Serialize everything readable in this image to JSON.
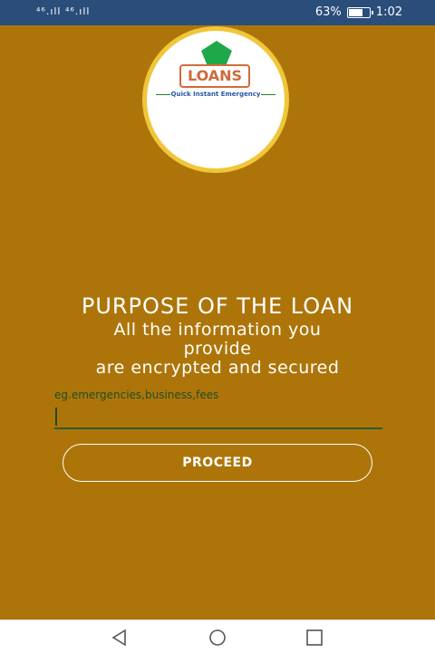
{
  "status_bar": {
    "signal": "⁴⁶.ıll ⁴⁶.ıll",
    "battery_percent": "63%",
    "time": "1:02"
  },
  "logo": {
    "brand": "LOANS",
    "tagline": "Quick Instant Emergency",
    "colors": {
      "pentagon": "#1fa84a",
      "ring": "#f0c63a",
      "brand_text": "#d06a3a",
      "tagline": "#2a56a3"
    }
  },
  "form": {
    "title": "PURPOSE OF THE LOAN",
    "subtitle_line1": "All the information you",
    "subtitle_line2": "provide",
    "subtitle_line3": "are encrypted and secured",
    "input_label": "eg.emergencies,business,fees",
    "input_value": "",
    "proceed_label": "PROCEED"
  },
  "nav": {
    "back": "back-icon",
    "home": "home-icon",
    "recent": "recent-apps-icon"
  },
  "colors": {
    "background": "#ad7509",
    "status_bar": "#2a4d79"
  }
}
